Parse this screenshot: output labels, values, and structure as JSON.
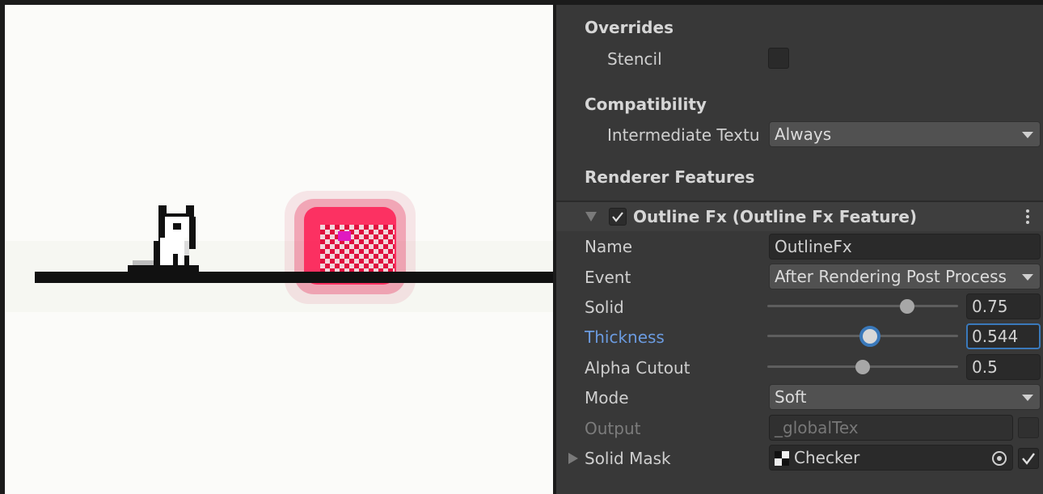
{
  "inspector": {
    "overrides": {
      "title": "Overrides",
      "stencil_label": "Stencil",
      "stencil_checked": false
    },
    "compatibility": {
      "title": "Compatibility",
      "intermediate_label": "Intermediate Textu",
      "intermediate_value": "Always"
    },
    "renderer_features_title": "Renderer Features",
    "feature": {
      "enabled": true,
      "title": "Outline Fx (Outline Fx Feature)",
      "fields": {
        "name_label": "Name",
        "name_value": "OutlineFx",
        "event_label": "Event",
        "event_value": "After Rendering Post Process",
        "solid_label": "Solid",
        "solid_value": "0.75",
        "thickness_label": "Thickness",
        "thickness_value": "0.544",
        "alpha_label": "Alpha Cutout",
        "alpha_value": "0.5",
        "mode_label": "Mode",
        "mode_value": "Soft",
        "output_label": "Output",
        "output_value": "_globalTex",
        "output_checked": false,
        "mask_label": "Solid Mask",
        "mask_value": "Checker",
        "mask_checked": true
      }
    }
  },
  "colors": {
    "scene_bg": "#fbfbf9",
    "glow": "#ff0a46",
    "focus": "#3a79bb",
    "active_label": "#6b9be0"
  },
  "icons": [
    "checkbox-empty-icon",
    "foldout-arrow-icon",
    "checkmark-icon",
    "kebab-menu-icon",
    "dropdown-arrow-icon",
    "object-picker-icon",
    "checker-texture-icon"
  ]
}
